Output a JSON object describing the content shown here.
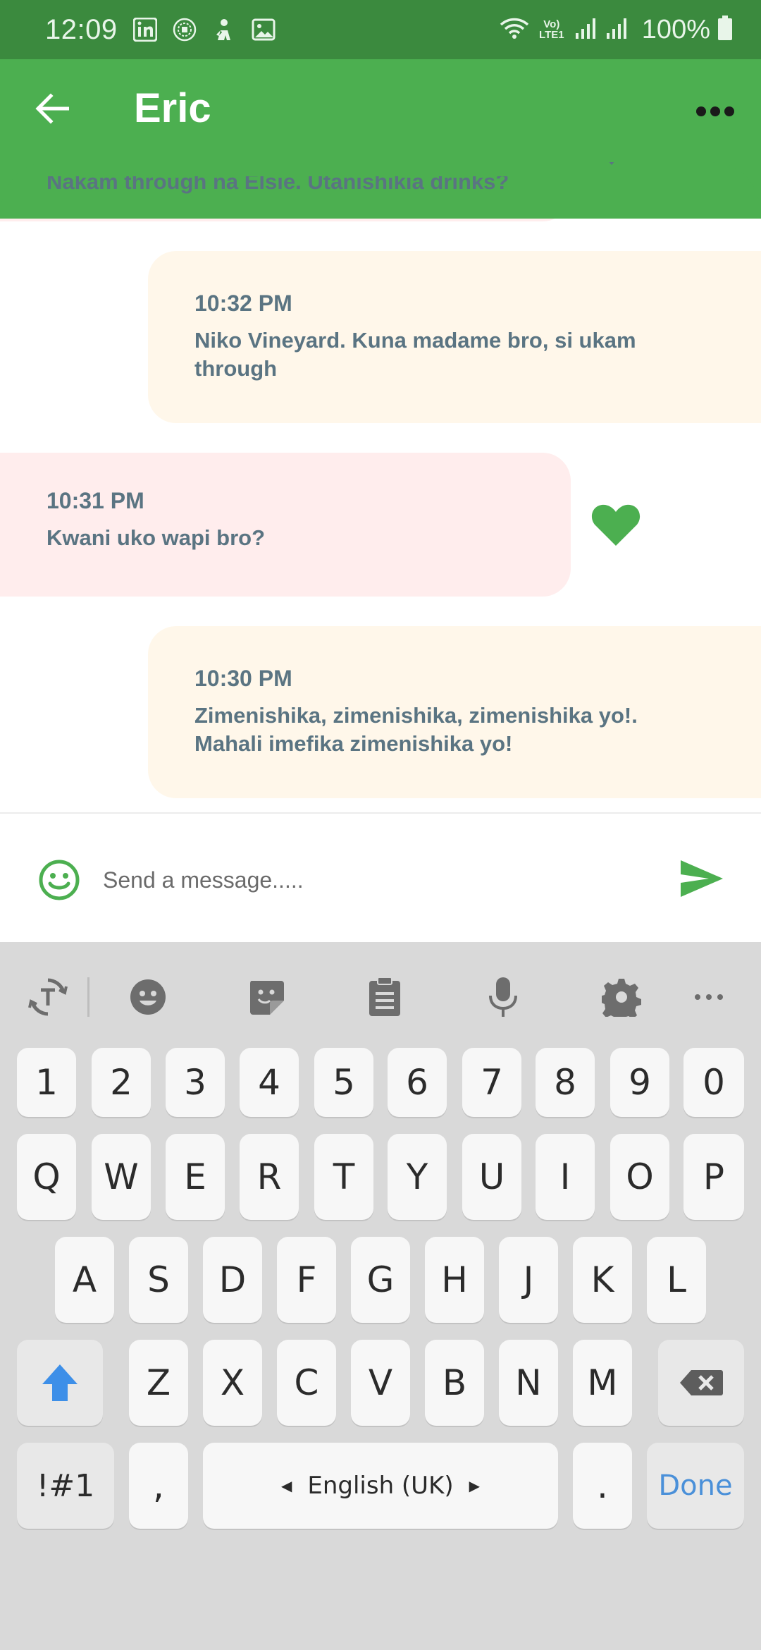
{
  "status_bar": {
    "time": "12:09",
    "battery": "100%",
    "icons": [
      "linkedin-icon",
      "club-crest-icon",
      "person-icon",
      "image-icon",
      "wifi-icon",
      "volte-icon",
      "signal-icon",
      "signal-icon",
      "battery-icon"
    ],
    "network_label": "Vo) LTE1"
  },
  "app_bar": {
    "title": "Eric",
    "color": "#4caf50"
  },
  "messages": [
    {
      "direction": "received",
      "time": "",
      "text": "Nakam through na Elsie. Utanishikia drinks?",
      "liked": true
    },
    {
      "direction": "sent",
      "time": "10:32 PM",
      "text": "Niko Vineyard. Kuna madame bro, si ukam through"
    },
    {
      "direction": "received",
      "time": "10:31 PM",
      "text": "Kwani uko wapi bro?",
      "liked": true
    },
    {
      "direction": "sent",
      "time": "10:30 PM",
      "text": "Zimenishika, zimenishika, zimenishika yo!. Mahali imefika zimenishika yo!"
    }
  ],
  "composer": {
    "placeholder": "Send a message....."
  },
  "keyboard": {
    "toolbar": [
      "text-convert-icon",
      "emoji-icon",
      "sticker-icon",
      "clipboard-icon",
      "microphone-icon",
      "settings-icon",
      "more-icon"
    ],
    "row_numbers": [
      "1",
      "2",
      "3",
      "4",
      "5",
      "6",
      "7",
      "8",
      "9",
      "0"
    ],
    "row_1": [
      "Q",
      "W",
      "E",
      "R",
      "T",
      "Y",
      "U",
      "I",
      "O",
      "P"
    ],
    "row_2": [
      "A",
      "S",
      "D",
      "F",
      "G",
      "H",
      "J",
      "K",
      "L"
    ],
    "row_3": [
      "Z",
      "X",
      "C",
      "V",
      "B",
      "N",
      "M"
    ],
    "symbols_key": "!#1",
    "comma_key": ",",
    "space_key": "English (UK)",
    "period_key": ".",
    "done_key": "Done"
  },
  "colors": {
    "status_bar": "#3b8a3e",
    "accent": "#4caf50",
    "received_bubble": "#ffeded",
    "sent_bubble": "#fff7ea",
    "message_text": "#5a7482"
  }
}
